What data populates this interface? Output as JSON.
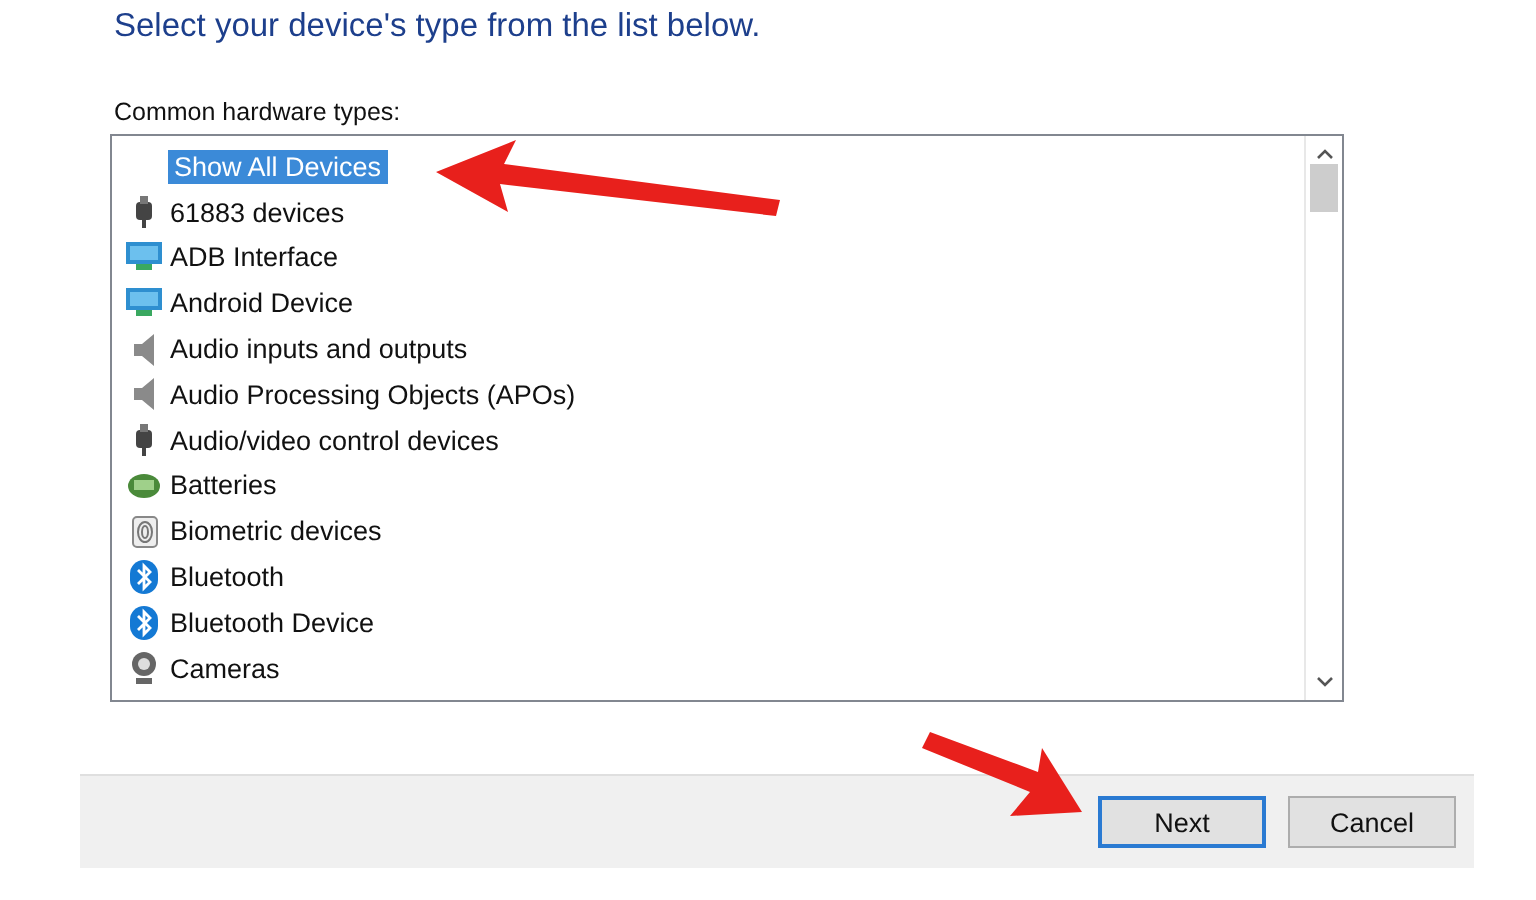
{
  "heading": "Select your device's type from the list below.",
  "list_label": "Common hardware types:",
  "items": [
    {
      "label": "Show All Devices",
      "kind": "none",
      "selected": true
    },
    {
      "label": "61883 devices",
      "kind": "plug",
      "selected": false
    },
    {
      "label": "ADB Interface",
      "kind": "monitor",
      "selected": false
    },
    {
      "label": "Android Device",
      "kind": "monitor",
      "selected": false
    },
    {
      "label": "Audio inputs and outputs",
      "kind": "speaker",
      "selected": false
    },
    {
      "label": "Audio Processing Objects (APOs)",
      "kind": "speaker",
      "selected": false
    },
    {
      "label": "Audio/video control devices",
      "kind": "plug",
      "selected": false
    },
    {
      "label": "Batteries",
      "kind": "battery",
      "selected": false
    },
    {
      "label": "Biometric devices",
      "kind": "fingerprint",
      "selected": false
    },
    {
      "label": "Bluetooth",
      "kind": "bluetooth",
      "selected": false
    },
    {
      "label": "Bluetooth Device",
      "kind": "bluetooth",
      "selected": false
    },
    {
      "label": "Cameras",
      "kind": "camera",
      "selected": false
    }
  ],
  "buttons": [
    {
      "label": "Next",
      "default": true
    },
    {
      "label": "Cancel",
      "default": false
    }
  ]
}
